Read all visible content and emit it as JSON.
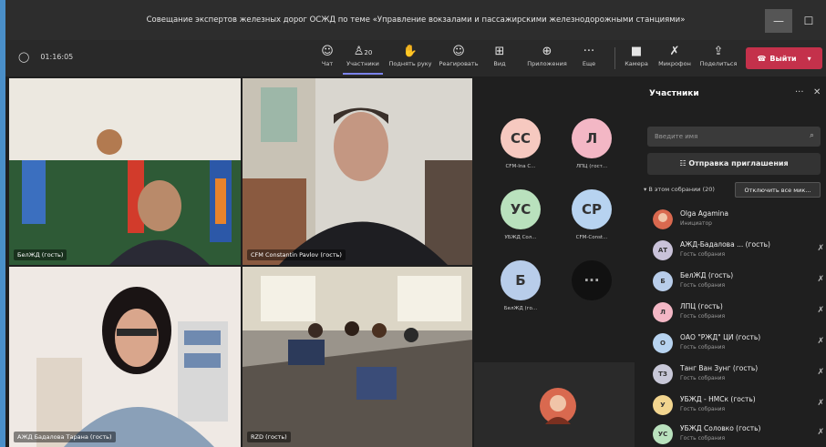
{
  "window": {
    "title": "Совещание экспертов железных дорог ОСЖД по теме «Управление вокзалами и пассажирскими железнодорожными станциями»"
  },
  "toolbar": {
    "timer": "01:16:05",
    "chat": "Чат",
    "participants": "Участники",
    "participants_count": "20",
    "raise_hand": "Поднять руку",
    "react": "Реагировать",
    "view": "Вид",
    "apps": "Приложения",
    "more": "Еще",
    "camera": "Камера",
    "mic": "Микрофон",
    "share": "Поделиться",
    "leave": "Выйти"
  },
  "videos": [
    {
      "name": "БелЖД (гость)"
    },
    {
      "name": "CFM Constantin Pavlov (гость)"
    },
    {
      "name": "АЖД Бадалова Тарана (гость)"
    },
    {
      "name": "RZD (гость)"
    }
  ],
  "avatars": [
    {
      "initials": "CC",
      "label": "CFM-Ina C...",
      "color": "#f6c9c0"
    },
    {
      "initials": "Л",
      "label": "ЛПЦ (гост...",
      "color": "#f3b7c5"
    },
    {
      "initials": "УС",
      "label": "УБЖД Сол...",
      "color": "#b9e1bd"
    },
    {
      "initials": "CP",
      "label": "CFM-Const...",
      "color": "#b7d3f0"
    },
    {
      "initials": "Б",
      "label": "БелЖД (го...",
      "color": "#b8cdea"
    }
  ],
  "panel": {
    "title": "Участники",
    "search_placeholder": "Введите имя",
    "invite_label": "Отправка приглашения",
    "in_meeting": "В этом собрании (20)",
    "mute_all": "Отключить все мик...",
    "participants": [
      {
        "initials": "",
        "name": "Olga Agamina",
        "role": "Инициатор",
        "color": "#d9694f"
      },
      {
        "initials": "АТ",
        "name": "АЖД-Бадалова ... (гость)",
        "role": "Гость собрания",
        "color": "#c9c2d9"
      },
      {
        "initials": "Б",
        "name": "БелЖД (гость)",
        "role": "Гость собрания",
        "color": "#b8cdea"
      },
      {
        "initials": "Л",
        "name": "ЛПЦ (гость)",
        "role": "Гость собрания",
        "color": "#f3b7c5"
      },
      {
        "initials": "О",
        "name": "ОАО \"РЖД\" ЦИ (гость)",
        "role": "Гость собрания",
        "color": "#b7d3f0"
      },
      {
        "initials": "ТЗ",
        "name": "Танг Ван Зунг (гость)",
        "role": "Гость собрания",
        "color": "#c8c8d8"
      },
      {
        "initials": "У",
        "name": "УБЖД - НМСк (гость)",
        "role": "Гость собрания",
        "color": "#f2d58f"
      },
      {
        "initials": "УС",
        "name": "УБЖД Соловко (гость)",
        "role": "Гость собрания",
        "color": "#b9e1bd"
      }
    ]
  }
}
